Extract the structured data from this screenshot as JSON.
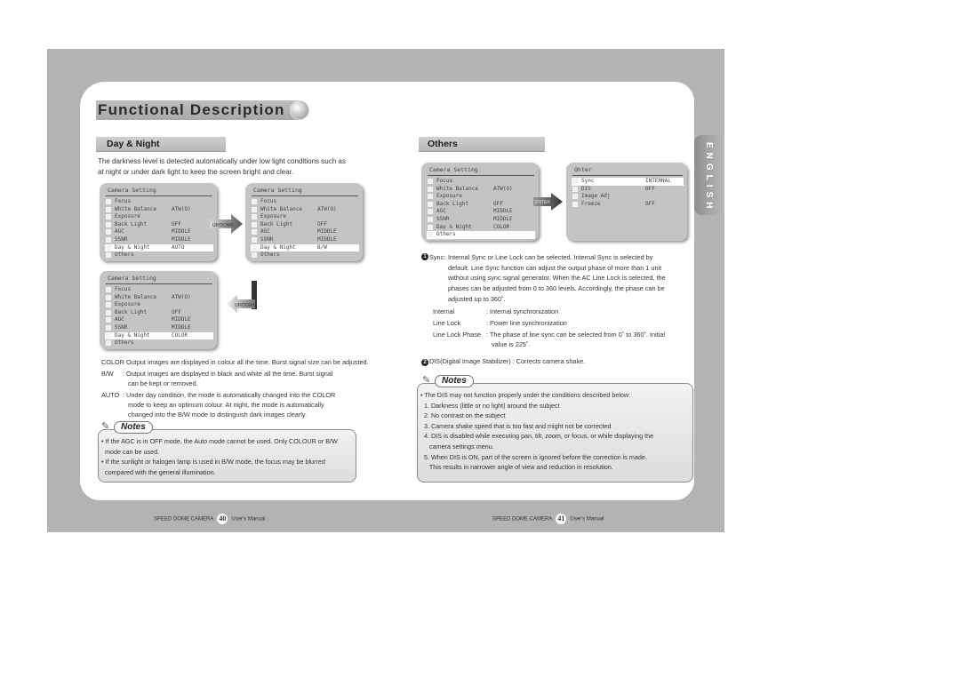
{
  "page": {
    "title": "Functional Description",
    "side_tab": "ENGLISH"
  },
  "left": {
    "section_title": "Day & Night",
    "intro": [
      "The darkness level is detected automatically under low light conditions such as",
      "at night or under dark light to keep the screen bright and clear."
    ],
    "menus": [
      {
        "title": "Camera Setting",
        "highlight": 6,
        "rows": [
          {
            "label": "Focus",
            "value": ""
          },
          {
            "label": "White Balance",
            "value": "ATW(O)"
          },
          {
            "label": "Exposure",
            "value": ""
          },
          {
            "label": "Back Light",
            "value": "OFF"
          },
          {
            "label": "AGC",
            "value": "MIDDLE"
          },
          {
            "label": "SSNR",
            "value": "MIDDLE"
          },
          {
            "label": "Day & Night",
            "value": "AUTO"
          },
          {
            "label": "Others",
            "value": ""
          }
        ]
      },
      {
        "title": "Camera Setting",
        "highlight": 6,
        "rows": [
          {
            "label": "Focus",
            "value": ""
          },
          {
            "label": "White Balance",
            "value": "ATW(O)"
          },
          {
            "label": "Exposure",
            "value": ""
          },
          {
            "label": "Back Light",
            "value": "OFF"
          },
          {
            "label": "AGC",
            "value": "MIDDLE"
          },
          {
            "label": "SSNR",
            "value": "MIDDLE"
          },
          {
            "label": "Day & Night",
            "value": "B/W"
          },
          {
            "label": "Others",
            "value": ""
          }
        ]
      },
      {
        "title": "Camera Setting",
        "highlight": 6,
        "rows": [
          {
            "label": "Focus",
            "value": ""
          },
          {
            "label": "White Balance",
            "value": "ATW(O)"
          },
          {
            "label": "Exposure",
            "value": ""
          },
          {
            "label": "Back Light",
            "value": "OFF"
          },
          {
            "label": "AGC",
            "value": "MIDDLE"
          },
          {
            "label": "SSNR",
            "value": "MIDDLE"
          },
          {
            "label": "Day & Night",
            "value": "COLOR"
          },
          {
            "label": "Others",
            "value": ""
          }
        ]
      }
    ],
    "arrow_labels": [
      "UP/DOWN",
      "UP/DOWN"
    ],
    "definitions": [
      {
        "key": "COLOR",
        "lines": [
          ": Output images are displayed in colour all the time. Burst signal size can be adjusted."
        ]
      },
      {
        "key": "B/W",
        "lines": [
          ": Output images are displayed in black and white all the time. Burst signal",
          "can be kept or removed."
        ]
      },
      {
        "key": "AUTO",
        "lines": [
          ": Under day condition, the mode is automatically changed into the COLOR",
          "mode to keep an optimum colour. At night, the mode is automatically",
          "changed into the B/W mode to distinguish dark images clearly."
        ]
      }
    ],
    "notes_label": "Notes",
    "notes": [
      "• If the AGC is in OFF mode, the Auto mode cannot be used. Only COLOUR or B/W",
      "  mode can be used.",
      "• If the sunlight or halogen lamp is used in B/W mode, the focus may be blurred",
      "  compared with the general illumination."
    ],
    "footer": {
      "product": "SPEED DOME CAMERA",
      "page": "40",
      "manual": "User's Manual"
    }
  },
  "right": {
    "section_title": "Others",
    "menus": [
      {
        "title": "Camera Setting",
        "highlight": 7,
        "rows": [
          {
            "label": "Focus",
            "value": ""
          },
          {
            "label": "White Balance",
            "value": "ATW(O)"
          },
          {
            "label": "Exposure",
            "value": ""
          },
          {
            "label": "Back Light",
            "value": "OFF"
          },
          {
            "label": "AGC",
            "value": "MIDDLE"
          },
          {
            "label": "SSNR",
            "value": "MIDDLE"
          },
          {
            "label": "Day & Night",
            "value": "COLOR"
          },
          {
            "label": "Others",
            "value": ""
          }
        ]
      },
      {
        "title": "Ohter",
        "highlight": 0,
        "rows": [
          {
            "label": "Sync",
            "value": "INTERNAL"
          },
          {
            "label": "DIS",
            "value": "OFF"
          },
          {
            "label": "Image Adj",
            "value": ""
          },
          {
            "label": "Freeze",
            "value": "OFF"
          }
        ]
      }
    ],
    "arrow_label": "ENTER",
    "sync": {
      "num": "1",
      "key": "Sync:",
      "lines": [
        "Internal Sync or Line Lock can be selected. Internal Sync is selected by",
        "default. Line Sync function can adjust the output phase of more than 1 unit",
        "without using sync signal generator. When the AC Line Lock is selected, the",
        "phases can be adjusted from 0 to 360 levels. Accordingly, the phase can be",
        "adjusted up to 360˚."
      ],
      "items": [
        {
          "key": "Internal",
          "lines": [
            ": Internal synchronization"
          ]
        },
        {
          "key": "Line Lock",
          "lines": [
            ": Power line synchronization"
          ]
        },
        {
          "key": "Line Lock Phase",
          "lines": [
            ": The phase of line sync can be selected from 0˚ to 360˚. Initial",
            "value is 225˚."
          ]
        }
      ]
    },
    "dis": {
      "num": "2",
      "text": "DIS(Digital Image Stabilizer) : Corrects camera shake."
    },
    "notes_label": "Notes",
    "notes": [
      "• The DIS may not function properly under the conditions described below:",
      "  1. Darkness (little or no light) around the subject",
      "  2. No contrast on the subject",
      "  3. Camera shake speed that is too fast and might not be corrected",
      "  4. DIS is disabled while executing pan, tilt, zoom, or focus, or while displaying the",
      "     camera settings menu.",
      "  5. When DIS is ON, part of the screen is ignored before the correction is made.",
      "     This results in narrower angle of view and reduction in resolution."
    ],
    "footer": {
      "product": "SPEED DOME CAMERA",
      "page": "41",
      "manual": "User's Manual"
    }
  }
}
